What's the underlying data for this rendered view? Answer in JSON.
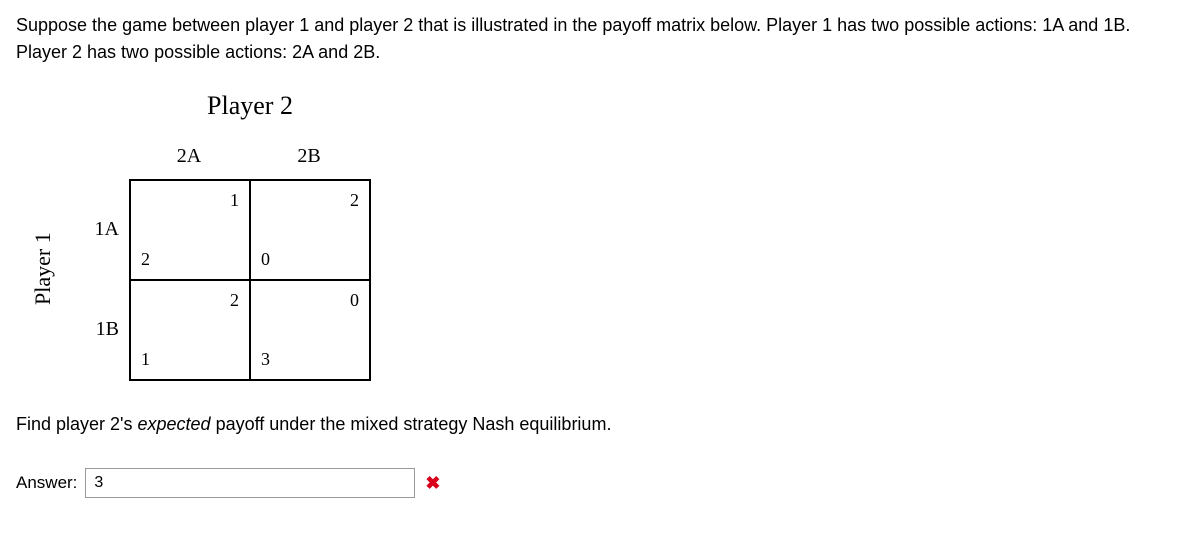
{
  "intro": "Suppose the game between player 1 and player 2 that is illustrated in the payoff matrix below.  Player 1 has two possible actions: 1A and 1B.  Player 2 has two possible actions: 2A and 2B.",
  "matrix": {
    "player1_label": "Player 1",
    "player2_label": "Player 2",
    "col_headers": [
      "2A",
      "2B"
    ],
    "row_headers": [
      "1A",
      "1B"
    ],
    "cells": {
      "r0c0": {
        "p1": "2",
        "p2": "1"
      },
      "r0c1": {
        "p1": "0",
        "p2": "2"
      },
      "r1c0": {
        "p1": "1",
        "p2": "2"
      },
      "r1c1": {
        "p1": "3",
        "p2": "0"
      }
    }
  },
  "question_prefix": "Find player 2's ",
  "question_italic": "expected",
  "question_suffix": " payoff under the mixed strategy Nash equilibrium.",
  "answer": {
    "label": "Answer:",
    "value": "3"
  }
}
